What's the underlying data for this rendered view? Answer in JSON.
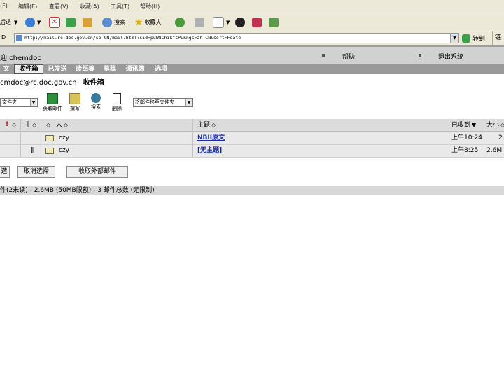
{
  "menu": [
    "(F)",
    "编辑(E)",
    "查看(V)",
    "收藏(A)",
    "工具(T)",
    "帮助(H)"
  ],
  "toolbar": {
    "back_label": "后退",
    "search_label": "搜索",
    "favorites_label": "收藏夹"
  },
  "address": {
    "label": "D",
    "url": "http://mail.rc.doc.gov.cn/sb-CN/mail.html?sid=puW8ChikfsPL&ngs=zh-CN&sort=Fdate",
    "go_label": "转到",
    "links_label": "链接"
  },
  "header": {
    "user": "迎 chemdoc",
    "help": "帮助",
    "logout": "退出系统"
  },
  "tabs": [
    "文",
    "收件箱",
    "已发送",
    "废纸篓",
    "草稿",
    "通讯簿",
    "选项"
  ],
  "account": {
    "email": "cmdoc@rc.doc.gov.cn",
    "folder": "收件箱"
  },
  "actions": {
    "folder_select": "文件夹",
    "get_mail": "获取邮件",
    "compose": "撰写",
    "search": "搜索",
    "delete": "删除",
    "move_select": "将邮件移至文件夹"
  },
  "table": {
    "headers": {
      "from": "人",
      "subject": "主题",
      "received": "已收到",
      "size": "大小"
    },
    "rows": [
      {
        "from": "czy",
        "subject": "NBII原文",
        "received": "上午10:24",
        "size": "2"
      },
      {
        "from": "czy",
        "subject": "[无主题]",
        "received": "上午8:25",
        "size": "2.6M"
      }
    ]
  },
  "buttons": {
    "select_all": "选",
    "deselect_all": "取消选择",
    "fetch_external": "收取外部邮件"
  },
  "status": "件(2未读) - 2.6MB (50MB限额) - 3 邮件总数 (无限制)"
}
